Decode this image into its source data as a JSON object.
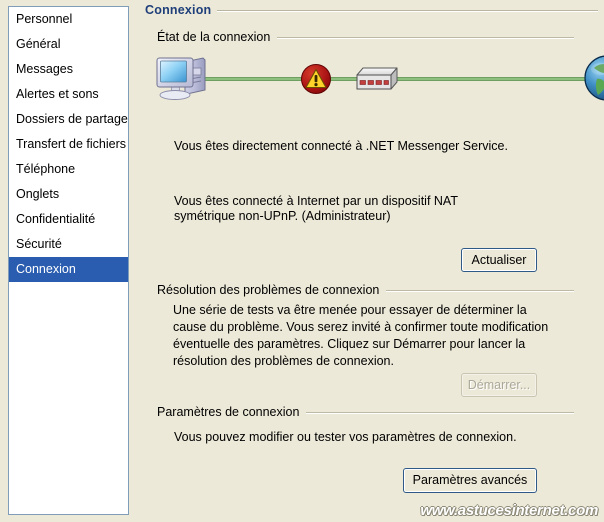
{
  "sidebar": {
    "items": [
      {
        "label": "Personnel",
        "selected": false
      },
      {
        "label": "Général",
        "selected": false
      },
      {
        "label": "Messages",
        "selected": false
      },
      {
        "label": "Alertes et sons",
        "selected": false
      },
      {
        "label": "Dossiers de partage",
        "selected": false
      },
      {
        "label": "Transfert de fichiers",
        "selected": false
      },
      {
        "label": "Téléphone",
        "selected": false
      },
      {
        "label": "Onglets",
        "selected": false
      },
      {
        "label": "Confidentialité",
        "selected": false
      },
      {
        "label": "Sécurité",
        "selected": false
      },
      {
        "label": "Connexion",
        "selected": true
      }
    ],
    "selected_label": "Connexion",
    "selection_bg": "#2a5db0",
    "selection_fg": "#ffffff"
  },
  "header": {
    "title": "Connexion",
    "title_color": "#1f3f7a"
  },
  "groups": {
    "etat": {
      "label": "État de la connexion"
    },
    "resolution": {
      "label": "Résolution des problèmes de connexion"
    },
    "parametres": {
      "label": "Paramètres de connexion"
    }
  },
  "diagram": {
    "nodes": [
      {
        "icon": "computer-icon",
        "name": "local-computer"
      },
      {
        "icon": "warning-icon",
        "name": "connection-warning"
      },
      {
        "icon": "router-icon",
        "name": "nat-router"
      },
      {
        "icon": "globe-icon",
        "name": "internet-globe"
      }
    ],
    "link_color": "#8fbf7f",
    "warning_color": "#a81010"
  },
  "main": {
    "status_text": "Vous êtes directement connecté à .NET Messenger Service.",
    "nat_text": "Vous êtes connecté à Internet par un dispositif NAT symétrique non-UPnP.  (Administrateur)",
    "resolution_text": "Une série de tests va être menée pour essayer de déterminer la cause du problème. Vous serez invité à confirmer toute modification éventuelle des paramètres. Cliquez sur Démarrer pour lancer la résolution des problèmes de connexion.",
    "parametres_text": "Vous pouvez modifier ou tester vos paramètres de connexion."
  },
  "buttons": {
    "actualiser": {
      "label": "Actualiser",
      "enabled": true
    },
    "demarrer": {
      "label": "Démarrer...",
      "enabled": false
    },
    "params_avances": {
      "label": "Paramètres avancés",
      "enabled": true
    }
  },
  "watermark": {
    "text": "www.astucesinternet.com"
  }
}
